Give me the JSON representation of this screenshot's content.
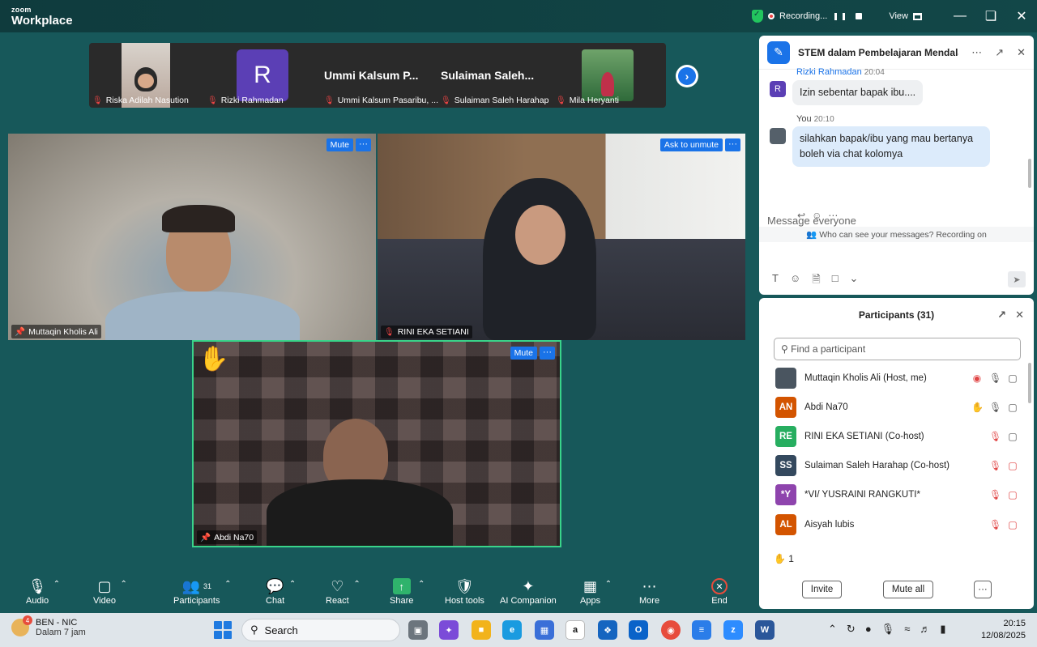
{
  "app": {
    "brand_small": "zoom",
    "brand_large": "Workplace"
  },
  "titlebar": {
    "recording_label": "Recording...",
    "view_label": "View"
  },
  "strip": {
    "thumbs": [
      {
        "name": "Riska Adilah Nasution"
      },
      {
        "name": "Rizki Rahmadan",
        "initial": "R"
      },
      {
        "name": "Ummi Kalsum Pasaribu, ...",
        "big": "Ummi Kalsum P..."
      },
      {
        "name": "Sulaiman Saleh Harahap",
        "big": "Sulaiman Saleh..."
      },
      {
        "name": "Mila Heryanti"
      }
    ]
  },
  "tiles": {
    "t1": {
      "name": "Muttaqin Kholis Ali",
      "action": "Mute",
      "more": "···"
    },
    "t2": {
      "name": "RINI EKA SETIANI",
      "action": "Ask to unmute",
      "more": "···"
    },
    "t3": {
      "name": "Abdi Na70",
      "action": "Mute",
      "more": "···"
    }
  },
  "toolbar": {
    "audio": "Audio",
    "video": "Video",
    "participants": "Participants",
    "participants_count": "31",
    "chat": "Chat",
    "react": "React",
    "share": "Share",
    "host_tools": "Host tools",
    "ai": "AI Companion",
    "apps": "Apps",
    "more": "More",
    "end": "End"
  },
  "chat": {
    "title": "STEM dalam Pembelajaran Mendalam",
    "messages": [
      {
        "sender": "Rizki Rahmadan",
        "time": "20:04",
        "text": "Izin sebentar bapak ibu....",
        "initial": "R"
      },
      {
        "sender": "You",
        "time": "20:10",
        "text": "silahkan bapak/ibu yang mau bertanya boleh via chat kolomya"
      }
    ],
    "visibility": "Who can see your messages? Recording on",
    "placeholder": "Message everyone"
  },
  "participants": {
    "title": "Participants (31)",
    "search_placeholder": "Find a participant",
    "list": [
      {
        "initials": "",
        "name": "Muttaqin Kholis Ali (Host, me)",
        "color": "#4a5560"
      },
      {
        "initials": "AN",
        "name": "Abdi Na70",
        "color": "#d35400"
      },
      {
        "initials": "RE",
        "name": "RINI EKA SETIANI (Co-host)",
        "color": "#27ae60"
      },
      {
        "initials": "SS",
        "name": "Sulaiman Saleh Harahap (Co-host)",
        "color": "#34495e"
      },
      {
        "initials": "*Y",
        "name": "*VI/ YUSRAINI RANGKUTI*",
        "color": "#8e44ad"
      },
      {
        "initials": "AL",
        "name": "Aisyah lubis",
        "color": "#d35400"
      }
    ],
    "raised_count": "1",
    "invite": "Invite",
    "mute_all": "Mute all",
    "more": "···"
  },
  "taskbar": {
    "weather_title": "BEN - NIC",
    "weather_sub": "Dalam 7 jam",
    "weather_badge": "4",
    "search": "Search",
    "time": "20:15",
    "date": "12/08/2025"
  }
}
